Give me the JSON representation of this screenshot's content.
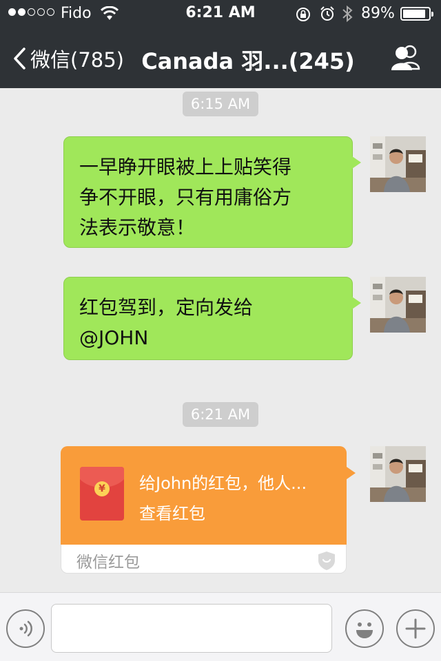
{
  "status_bar": {
    "carrier": "Fido",
    "time": "6:21 AM",
    "battery_percent": "89%",
    "battery_level": 0.89,
    "signal_bars_filled": 2,
    "signal_bars_total": 5
  },
  "nav": {
    "back_label": "微信(785)",
    "title": "Canada 羽...(245)"
  },
  "messages": [
    {
      "type": "timestamp",
      "text": "6:15 AM"
    },
    {
      "type": "text",
      "text": "一早睁开眼被上上贴笑得争不开眼，只有用庸俗方法表示敬意！",
      "lines": [
        "一早睁开眼被上上贴笑得",
        "争不开眼，只有用庸俗方",
        "法表示敬意！"
      ]
    },
    {
      "type": "text",
      "text": "红包驾到，定向发给@JOHN",
      "lines": [
        "红包驾到，定向发给",
        "@JOHN"
      ]
    },
    {
      "type": "timestamp",
      "text": "6:21 AM"
    },
    {
      "type": "red_packet",
      "title": "给John的红包，他人...",
      "subtitle": "查看红包",
      "label": "微信红包",
      "coin_symbol": "¥"
    }
  ],
  "input_bar": {
    "value": ""
  },
  "colors": {
    "nav_background": "#2e3236",
    "chat_background": "#ebebeb",
    "bubble_green": "#a0e75a",
    "red_packet_orange": "#f99c3a",
    "timestamp_pill": "#cecece"
  },
  "icons": [
    "back-chevron-icon",
    "wifi-icon",
    "rotation-lock-icon",
    "alarm-icon",
    "bluetooth-icon",
    "battery-icon",
    "group-members-icon",
    "voice-icon",
    "emoji-icon",
    "plus-icon",
    "shield-icon",
    "avatar"
  ]
}
